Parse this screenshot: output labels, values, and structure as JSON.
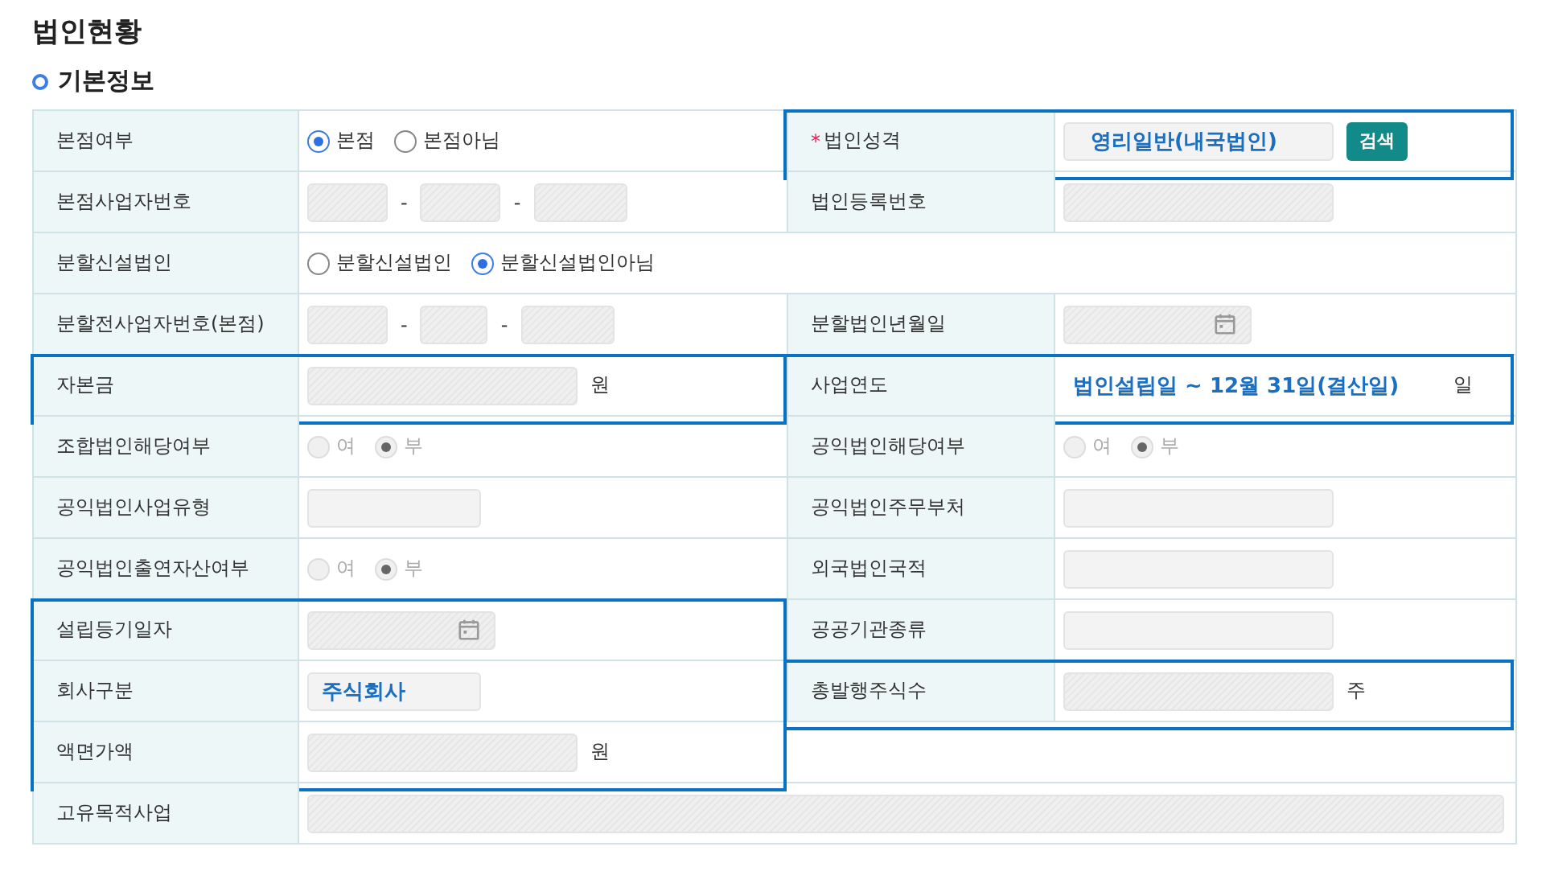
{
  "page_title": "법인현황",
  "section_title": "기본정보",
  "rows": [
    {
      "cells": [
        {
          "label": "본점여부",
          "highlighted": false,
          "items": [
            {
              "kind": "radio",
              "label": "본점",
              "selected": true,
              "disabled": false
            },
            {
              "kind": "radio",
              "label": "본점아님",
              "selected": false,
              "disabled": false
            }
          ]
        },
        {
          "label": "법인성격",
          "required_mark": "*",
          "highlighted": true,
          "items": [
            {
              "kind": "field",
              "disabled": false,
              "value": "영리일반(내국법인)"
            },
            {
              "kind": "button",
              "label": "검색"
            }
          ]
        }
      ]
    },
    {
      "cells": [
        {
          "label": "본점사업자번호",
          "highlighted": false,
          "items": [
            {
              "kind": "field",
              "disabled": true
            },
            {
              "kind": "text",
              "text": "-"
            },
            {
              "kind": "field",
              "disabled": true
            },
            {
              "kind": "text",
              "text": "-"
            },
            {
              "kind": "field",
              "disabled": true
            }
          ]
        },
        {
          "label": "법인등록번호",
          "highlighted": false,
          "items": [
            {
              "kind": "field",
              "disabled": true
            }
          ]
        }
      ]
    },
    {
      "cells": [
        {
          "label": "분할신설법인",
          "highlighted": false,
          "items": [
            {
              "kind": "radio",
              "label": "분할신설법인",
              "selected": false,
              "disabled": false
            },
            {
              "kind": "radio",
              "label": "분할신설법인아님",
              "selected": true,
              "disabled": false
            }
          ]
        }
      ]
    },
    {
      "cells": [
        {
          "label": "분할전사업자번호(본점)",
          "highlighted": false,
          "items": [
            {
              "kind": "field",
              "disabled": true
            },
            {
              "kind": "text",
              "text": "-"
            },
            {
              "kind": "field",
              "disabled": true
            },
            {
              "kind": "text",
              "text": "-"
            },
            {
              "kind": "field",
              "disabled": true
            }
          ]
        },
        {
          "label": "분할법인년월일",
          "highlighted": false,
          "items": [
            {
              "kind": "field",
              "disabled": true,
              "calendar": true
            }
          ]
        }
      ]
    },
    {
      "cells": [
        {
          "label": "자본금",
          "highlighted": true,
          "items": [
            {
              "kind": "field",
              "disabled": true
            },
            {
              "kind": "text",
              "text": "원"
            }
          ]
        },
        {
          "label": "사업연도",
          "highlighted": true,
          "items": [
            {
              "kind": "period",
              "text": "법인설립일 ~ 12월 31일(결산일)"
            },
            {
              "kind": "text",
              "text": "일"
            }
          ]
        }
      ]
    },
    {
      "cells": [
        {
          "label": "조합법인해당여부",
          "highlighted": false,
          "items": [
            {
              "kind": "radio",
              "label": "여",
              "selected": false,
              "disabled": true
            },
            {
              "kind": "radio",
              "label": "부",
              "selected": true,
              "disabled": true
            }
          ]
        },
        {
          "label": "공익법인해당여부",
          "highlighted": false,
          "items": [
            {
              "kind": "radio",
              "label": "여",
              "selected": false,
              "disabled": true
            },
            {
              "kind": "radio",
              "label": "부",
              "selected": true,
              "disabled": true
            }
          ]
        }
      ]
    },
    {
      "cells": [
        {
          "label": "공익법인사업유형",
          "highlighted": false,
          "items": [
            {
              "kind": "field",
              "disabled": false
            }
          ]
        },
        {
          "label": "공익법인주무부처",
          "highlighted": false,
          "items": [
            {
              "kind": "field",
              "disabled": false
            }
          ]
        }
      ]
    },
    {
      "cells": [
        {
          "label": "공익법인출연자산여부",
          "highlighted": false,
          "items": [
            {
              "kind": "radio",
              "label": "여",
              "selected": false,
              "disabled": true
            },
            {
              "kind": "radio",
              "label": "부",
              "selected": true,
              "disabled": true
            }
          ]
        },
        {
          "label": "외국법인국적",
          "highlighted": false,
          "items": [
            {
              "kind": "field",
              "disabled": false
            }
          ]
        }
      ]
    },
    {
      "cells": [
        {
          "label": "설립등기일자",
          "highlighted": true,
          "items": [
            {
              "kind": "field",
              "disabled": true,
              "calendar": true
            }
          ]
        },
        {
          "label": "공공기관종류",
          "highlighted": false,
          "items": [
            {
              "kind": "field",
              "disabled": false
            }
          ]
        }
      ]
    },
    {
      "cells": [
        {
          "label": "회사구분",
          "highlighted": true,
          "items": [
            {
              "kind": "field",
              "disabled": false,
              "value": "주식회사"
            }
          ]
        },
        {
          "label": "총발행주식수",
          "highlighted": true,
          "items": [
            {
              "kind": "field",
              "disabled": true
            },
            {
              "kind": "text",
              "text": "주"
            }
          ]
        }
      ]
    },
    {
      "cells": [
        {
          "label": "액면가액",
          "highlighted": true,
          "items": [
            {
              "kind": "field",
              "disabled": true
            },
            {
              "kind": "text",
              "text": "원"
            }
          ]
        }
      ]
    },
    {
      "cells": [
        {
          "label": "고유목적사업",
          "highlighted": false,
          "items": [
            {
              "kind": "field",
              "disabled": true
            }
          ]
        }
      ]
    }
  ]
}
